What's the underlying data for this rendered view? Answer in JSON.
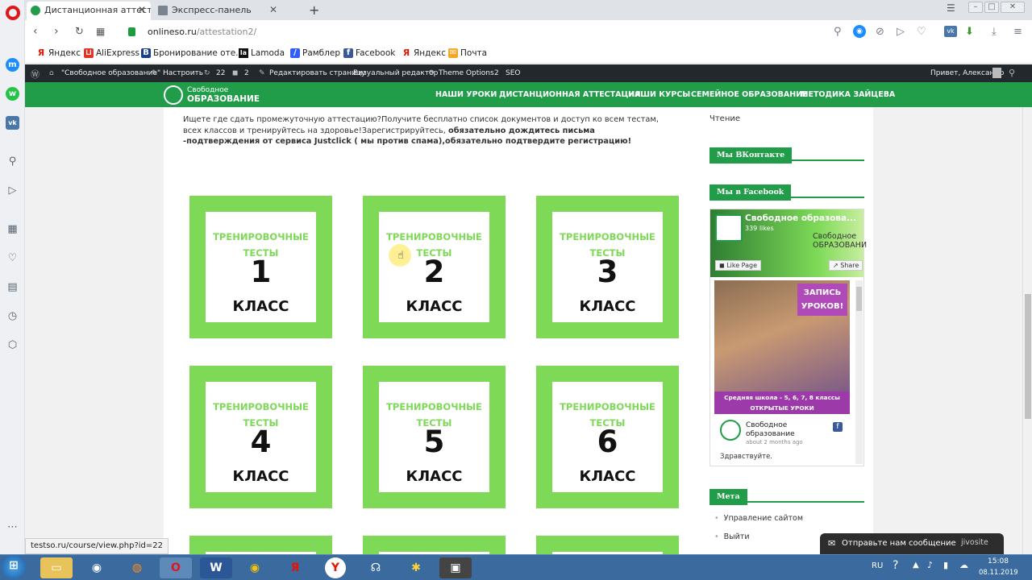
{
  "browser": {
    "tabs": [
      {
        "title": "Дистанционная аттестаци",
        "active": true
      },
      {
        "title": "Экспресс-панель",
        "active": false
      }
    ],
    "url_domain": "onlineso.ru",
    "url_path": "/attestation2/",
    "bookmarks": [
      "Яндекс",
      "AliExpress",
      "Бронирование оте...",
      "Lamoda",
      "Рамблер",
      "Facebook",
      "Яндекс",
      "Почта"
    ]
  },
  "wp_bar": {
    "site": "\"Свободное образование\"",
    "customize": "Настроить",
    "updates": "22",
    "comments": "2",
    "edit": "Редактировать страницу",
    "visual": "Визуальный редактор",
    "theme_options": "Theme Options",
    "theme_count": "2",
    "seo": "SEO",
    "greeting": "Привет, Александр"
  },
  "site": {
    "logo_top": "Свободное",
    "logo_bottom": "ОБРАЗОВАНИЕ",
    "menu": [
      "НАШИ УРОКИ",
      "ДИСТАНЦИОННАЯ АТТЕСТАЦИЯ",
      "НАШИ КУРСЫ",
      "СЕМЕЙНОЕ ОБРАЗОВАНИЕ",
      "МЕТОДИКА ЗАЙЦЕВА"
    ]
  },
  "intro": {
    "part1": "Ищете где сдать промежуточную аттестацию?Получите бесплатно список документов и доступ ко всем тестам, всех классов и тренируйтесь на здоровье!Зарегистрируйтесь, ",
    "part2": "обязательно дождитесь письма -подтверждения от сервиса Justclick ( мы против спама),обязательно  подтвердите регистрацию!"
  },
  "cards": {
    "title_line1": "ТРЕНИРОВОЧНЫЕ",
    "title_line2": "ТЕСТЫ",
    "class_label": "КЛАСС",
    "numbers": [
      "1",
      "2",
      "3",
      "4",
      "5",
      "6"
    ]
  },
  "sidebar": {
    "reading": "Чтение",
    "vk_title": "Мы ВКонтакте",
    "fb_title": "Мы в Facebook",
    "fb_page_name": "Свободное образова...",
    "fb_likes": "339 likes",
    "fb_like_btn": "Like Page",
    "fb_share_btn": "Share",
    "fb_cover_text": "Свободное ОБРАЗОВАНИ",
    "promo_top1": "ЗАПИСЬ",
    "promo_top2": "УРОКОВ!",
    "promo_bottom1": "Средняя школа - 5, 6, 7, 8 классы",
    "promo_bottom2": "ОТКРЫТЫЕ УРОКИ",
    "post_author1": "Свободное",
    "post_author2": "образование",
    "post_time": "about 2 months ago",
    "post_text": "Здравствуйте.",
    "meta_title": "Мета",
    "meta_links": [
      "Управление сайтом",
      "Выйти"
    ]
  },
  "status_link": "testso.ru/course/view.php?id=22",
  "jivo": {
    "message": "Отправьте нам сообщение",
    "brand": "jivosite"
  },
  "tray": {
    "lang": "RU",
    "time": "15:08",
    "date": "08.11.2019"
  }
}
